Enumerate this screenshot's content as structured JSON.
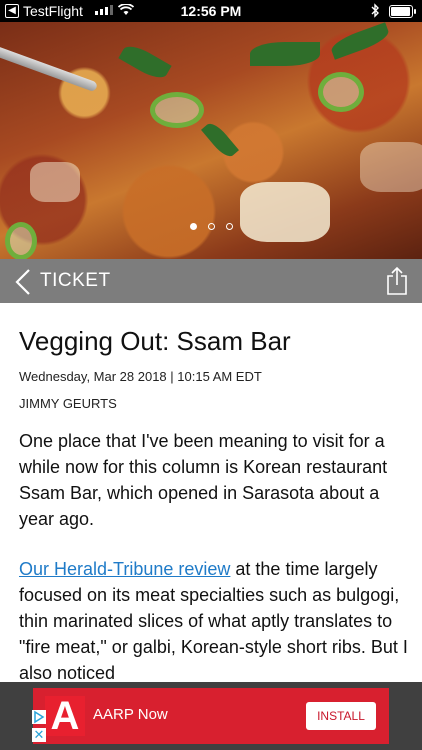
{
  "status_bar": {
    "back_app": "TestFlight",
    "time": "12:56 PM"
  },
  "hero": {
    "slide_count": 3,
    "active_slide": 1
  },
  "section_bar": {
    "title": "TICKET"
  },
  "article": {
    "headline": "Vegging Out: Ssam Bar",
    "date": "Wednesday, Mar 28 2018 | 10:15 AM EDT",
    "author": "JIMMY GEURTS",
    "paragraph1": "One place that I've been meaning to visit for a while now for this column is Korean restaurant Ssam Bar, which opened in Sarasota about a year ago.",
    "paragraph2_link": "Our Herald-Tribune review",
    "paragraph2_rest": " at the time largely focused on its meat specialties such as bulgogi, thin marinated slices of what aptly translates to \"fire meat,\" or galbi, Korean-style short ribs. But I also noticed"
  },
  "ad": {
    "brand": "AARP Now",
    "logo_letter": "A",
    "install_label": "INSTALL",
    "color": "#d8202f"
  }
}
